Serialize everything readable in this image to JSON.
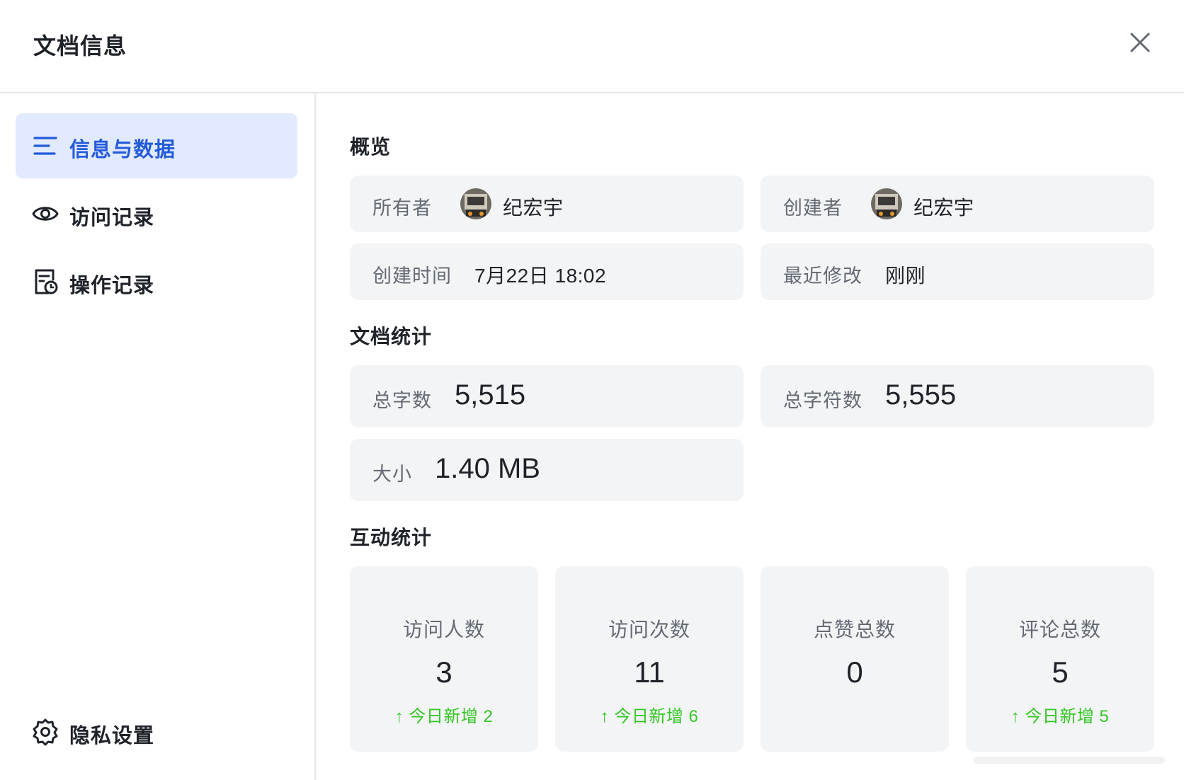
{
  "dialog": {
    "title": "文档信息",
    "close_icon": "close-icon"
  },
  "sidebar": {
    "items": [
      {
        "label": "信息与数据",
        "icon": "list-lines-icon",
        "active": true
      },
      {
        "label": "访问记录",
        "icon": "eye-icon",
        "active": false
      },
      {
        "label": "操作记录",
        "icon": "doc-clock-icon",
        "active": false
      }
    ],
    "bottom": {
      "label": "隐私设置",
      "icon": "gear-icon"
    }
  },
  "overview": {
    "title": "概览",
    "owner": {
      "label": "所有者",
      "name": "纪宏宇"
    },
    "creator": {
      "label": "创建者",
      "name": "纪宏宇"
    },
    "created_time": {
      "label": "创建时间",
      "value": "7月22日 18:02"
    },
    "modified": {
      "label": "最近修改",
      "value": "刚刚"
    }
  },
  "doc_stats": {
    "title": "文档统计",
    "total_words": {
      "label": "总字数",
      "value": "5,515"
    },
    "total_chars": {
      "label": "总字符数",
      "value": "5,555"
    },
    "size": {
      "label": "大小",
      "value": "1.40 MB"
    }
  },
  "interaction": {
    "title": "互动统计",
    "items": [
      {
        "label": "访问人数",
        "value": "3",
        "delta": "↑ 今日新增 2"
      },
      {
        "label": "访问次数",
        "value": "11",
        "delta": "↑ 今日新增 6"
      },
      {
        "label": "点赞总数",
        "value": "0",
        "delta": ""
      },
      {
        "label": "评论总数",
        "value": "5",
        "delta": "↑ 今日新增 5"
      }
    ]
  },
  "colors": {
    "accent": "#245bdb",
    "active_bg": "#e1eaff",
    "card_bg": "#f3f4f6",
    "positive": "#34c724"
  }
}
